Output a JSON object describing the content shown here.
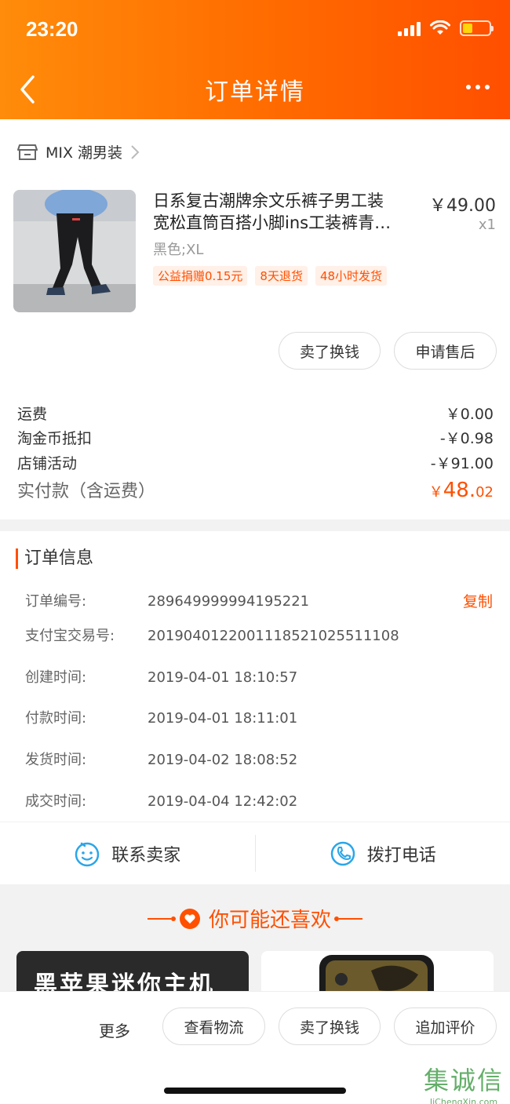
{
  "status": {
    "time": "23:20"
  },
  "nav": {
    "title": "订单详情"
  },
  "shop": {
    "name": "MIX 潮男装"
  },
  "product": {
    "title_line1": "日系复古潮牌余文乐裤子男工装",
    "title_line2": "宽松直筒百搭小脚ins工装裤青…",
    "sku": "黑色;XL",
    "price": "￥49.00",
    "qty": "x1",
    "tags": [
      "公益捐赠0.15元",
      "8天退货",
      "48小时发货"
    ]
  },
  "item_actions": {
    "sell": "卖了换钱",
    "after_sale": "申请售后"
  },
  "fees": [
    {
      "label": "运费",
      "value": "￥0.00"
    },
    {
      "label": "淘金币抵扣",
      "value": "-￥0.98"
    },
    {
      "label": "店铺活动",
      "value": "-￥91.00"
    }
  ],
  "total": {
    "label": "实付款（含运费）",
    "currency": "￥",
    "int": "48.",
    "dec": "02"
  },
  "order_info": {
    "title": "订单信息",
    "copy_label": "复制",
    "rows": [
      {
        "key": "订单编号:",
        "value": "289649999994195221"
      },
      {
        "key": "支付宝交易号:",
        "value": "2019040122001118521025511108"
      },
      {
        "key": "创建时间:",
        "value": "2019-04-01 18:10:57"
      },
      {
        "key": "付款时间:",
        "value": "2019-04-01 18:11:01"
      },
      {
        "key": "发货时间:",
        "value": "2019-04-02 18:08:52"
      },
      {
        "key": "成交时间:",
        "value": "2019-04-04 12:42:02"
      }
    ]
  },
  "contact": {
    "seller": "联系卖家",
    "phone": "拨打电话"
  },
  "recommend": {
    "title": "你可能还喜欢",
    "card1_text": "黑苹果迷你主机"
  },
  "bottom": {
    "more": "更多",
    "logistics": "查看物流",
    "sell": "卖了换钱",
    "review": "追加评价"
  },
  "watermark": {
    "big": "集诚信",
    "small": "JiChengXin.com"
  },
  "colors": {
    "accent": "#ff5000",
    "header_start": "#ff8c0a",
    "header_end": "#ff4f00"
  }
}
